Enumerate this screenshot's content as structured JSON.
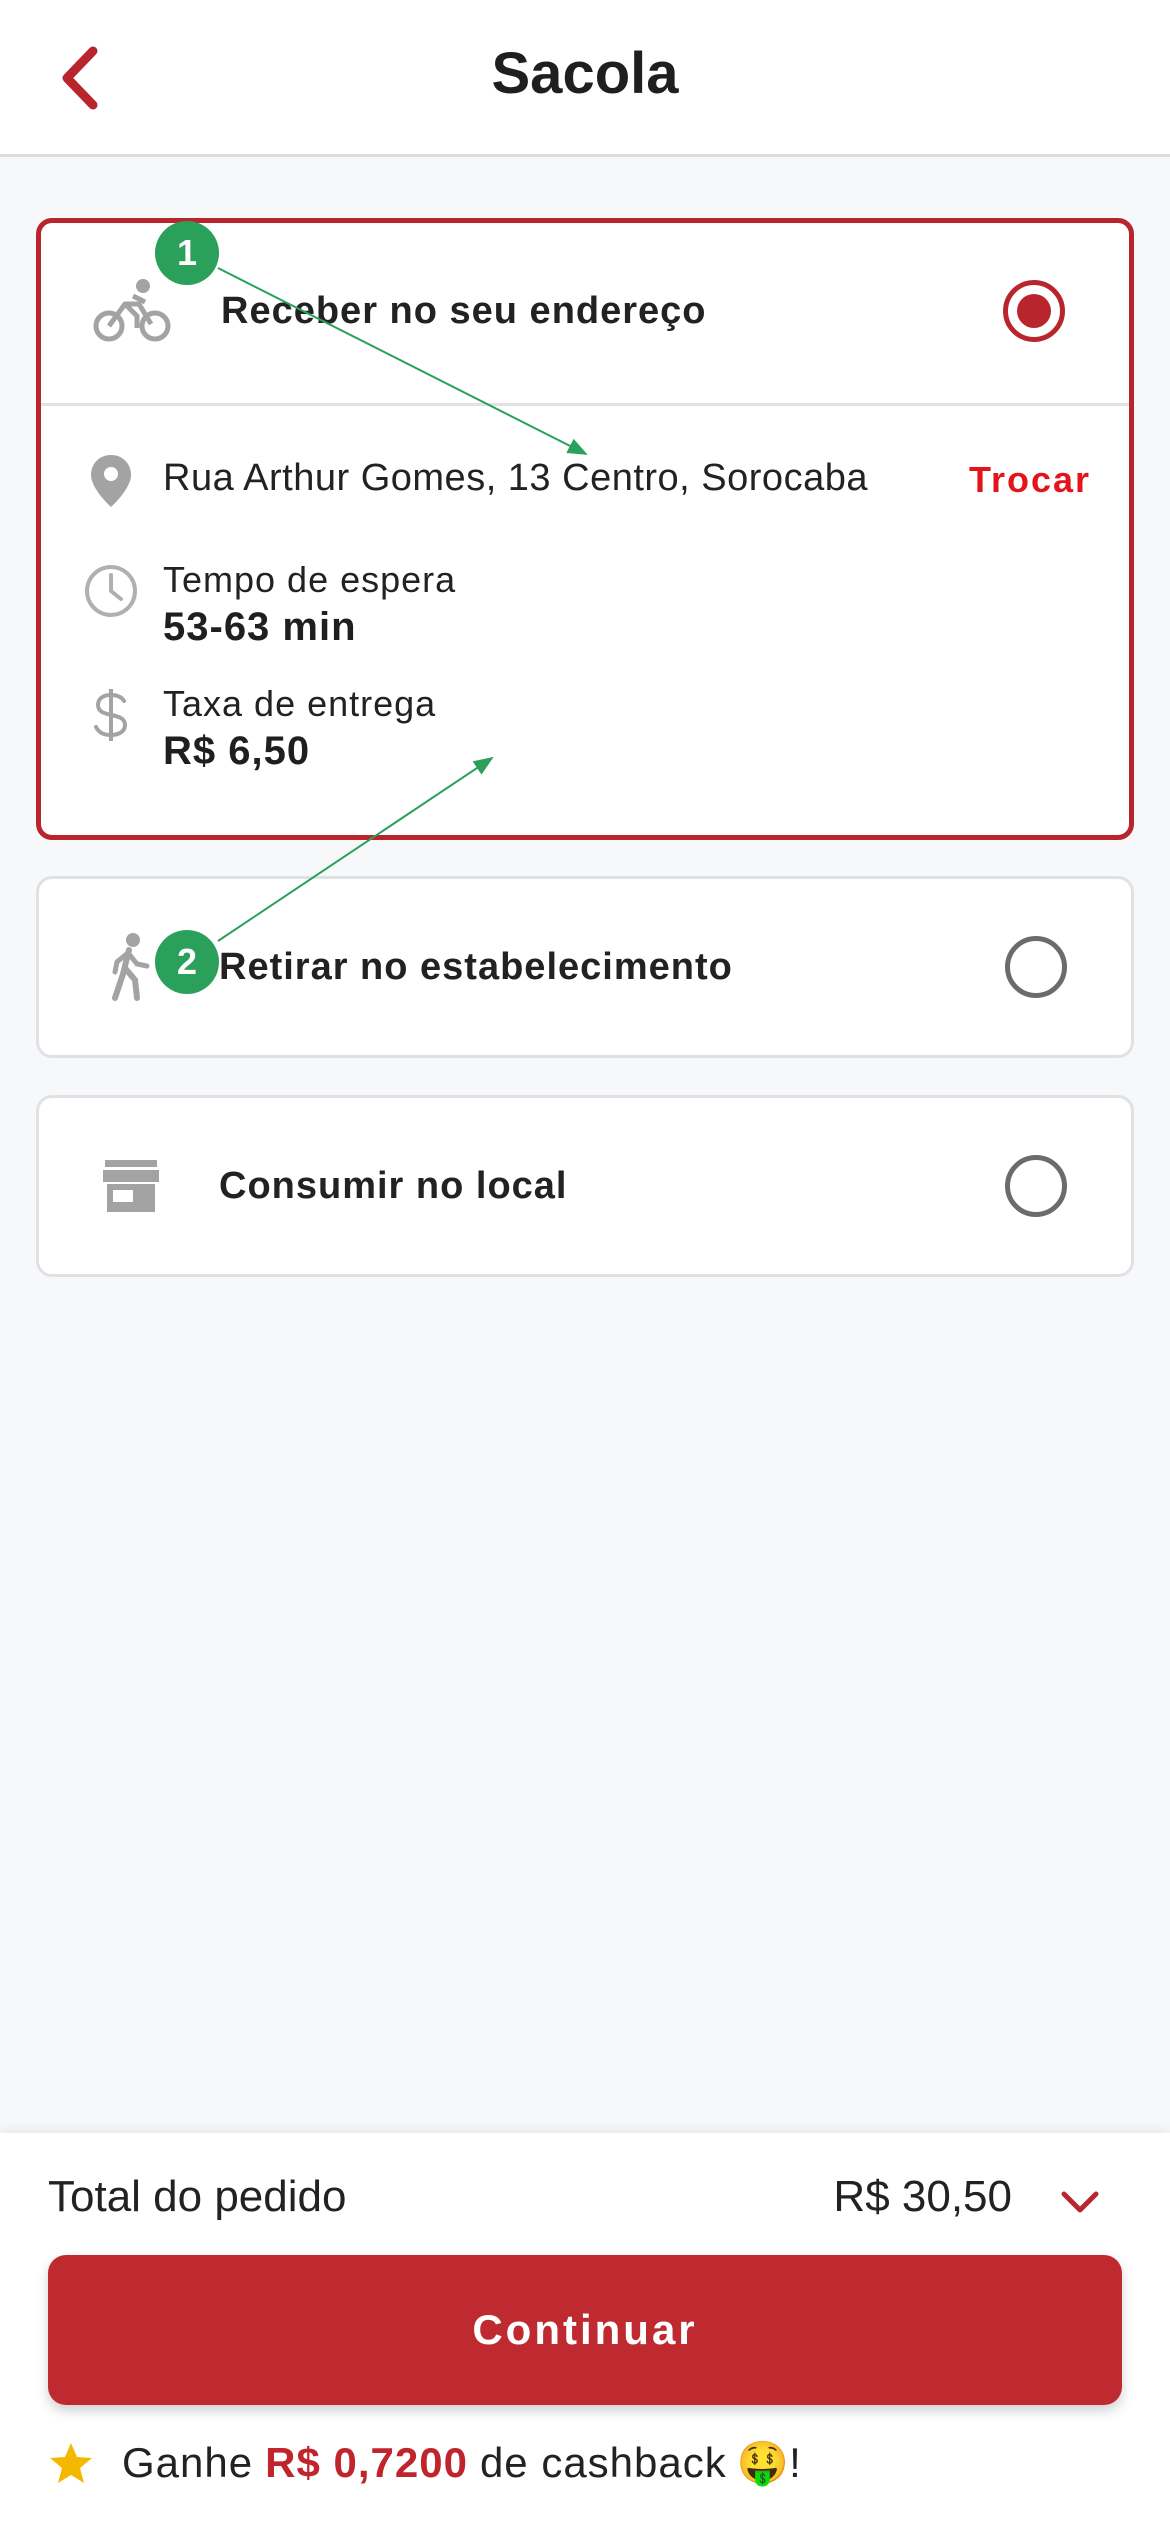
{
  "header": {
    "title": "Sacola"
  },
  "options": {
    "delivery": {
      "label": "Receber no seu endereço",
      "selected": true,
      "address": "Rua Arthur Gomes, 13 Centro, Sorocaba",
      "change_label": "Trocar",
      "wait_label": "Tempo de espera",
      "wait_value": "53-63 min",
      "fee_label": "Taxa de entrega",
      "fee_value": "R$ 6,50"
    },
    "pickup": {
      "label": "Retirar no estabelecimento",
      "selected": false
    },
    "dinein": {
      "label": "Consumir no local",
      "selected": false
    }
  },
  "annotations": {
    "marker1": "1",
    "marker2": "2"
  },
  "footer": {
    "total_label": "Total do pedido",
    "total_value": "R$ 30,50",
    "continue_label": "Continuar",
    "cashback_prefix": "Ganhe",
    "cashback_amount": "R$ 0,7200",
    "cashback_suffix": "de cashback",
    "cashback_emoji": "🤑",
    "cashback_end": "!"
  },
  "colors": {
    "accent": "#b8252c",
    "button": "#bf2a30",
    "link": "#e3141b",
    "marker": "#2ba05b",
    "star": "#f5b800"
  }
}
